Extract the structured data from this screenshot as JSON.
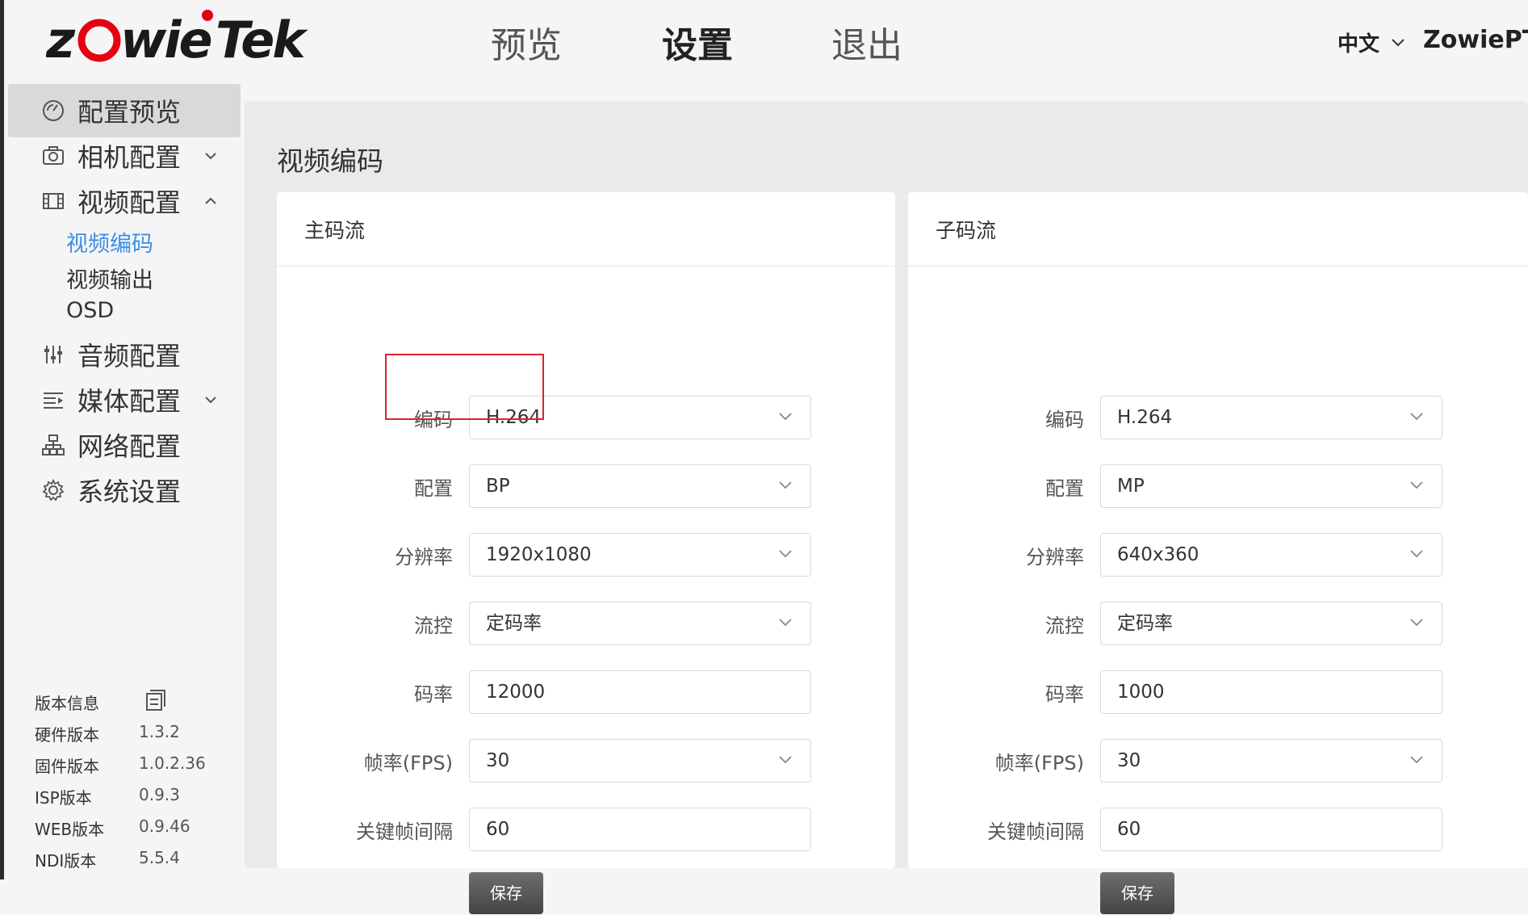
{
  "header": {
    "logo": "ZowieTek",
    "nav": [
      "预览",
      "设置",
      "退出"
    ],
    "active_nav": "设置",
    "language": "中文",
    "user": "ZowiePTZ"
  },
  "sidebar": {
    "items": [
      {
        "label": "配置预览",
        "icon": "gauge-icon",
        "active": true
      },
      {
        "label": "相机配置",
        "icon": "camera-icon",
        "expand": "chevron-down"
      },
      {
        "label": "视频配置",
        "icon": "film-icon",
        "expand": "chevron-up"
      },
      {
        "label": "音频配置",
        "icon": "mixer-icon"
      },
      {
        "label": "媒体配置",
        "icon": "media-icon",
        "expand": "chevron-down"
      },
      {
        "label": "网络配置",
        "icon": "network-icon"
      },
      {
        "label": "系统设置",
        "icon": "gear-icon"
      }
    ],
    "sub_items": [
      "视频编码",
      "视频输出",
      "OSD"
    ],
    "active_sub": "视频编码",
    "version_info": {
      "title": "版本信息",
      "rows": [
        {
          "label": "硬件版本",
          "value": "1.3.2"
        },
        {
          "label": "固件版本",
          "value": "1.0.2.36"
        },
        {
          "label": "ISP版本",
          "value": "0.9.3"
        },
        {
          "label": "WEB版本",
          "value": "0.9.46"
        },
        {
          "label": "NDI版本",
          "value": "5.5.4"
        }
      ]
    }
  },
  "main": {
    "title": "视频编码",
    "streams": [
      {
        "title": "主码流",
        "fields": [
          {
            "label": "编码",
            "value": "H.264",
            "type": "select"
          },
          {
            "label": "配置",
            "value": "BP",
            "type": "select"
          },
          {
            "label": "分辨率",
            "value": "1920x1080",
            "type": "select"
          },
          {
            "label": "流控",
            "value": "定码率",
            "type": "select"
          },
          {
            "label": "码率",
            "value": "12000",
            "type": "input"
          },
          {
            "label": "帧率(FPS)",
            "value": "30",
            "type": "select"
          },
          {
            "label": "关键帧间隔",
            "value": "60",
            "type": "input"
          }
        ],
        "save_label": "保存"
      },
      {
        "title": "子码流",
        "fields": [
          {
            "label": "编码",
            "value": "H.264",
            "type": "select"
          },
          {
            "label": "配置",
            "value": "MP",
            "type": "select"
          },
          {
            "label": "分辨率",
            "value": "640x360",
            "type": "select"
          },
          {
            "label": "流控",
            "value": "定码率",
            "type": "select"
          },
          {
            "label": "码率",
            "value": "1000",
            "type": "input"
          },
          {
            "label": "帧率(FPS)",
            "value": "30",
            "type": "select"
          },
          {
            "label": "关键帧间隔",
            "value": "60",
            "type": "input"
          }
        ],
        "save_label": "保存"
      }
    ]
  },
  "colors": {
    "accent": "#3b8fe6",
    "brand_red": "#e60012",
    "highlight": "#d9232e"
  }
}
